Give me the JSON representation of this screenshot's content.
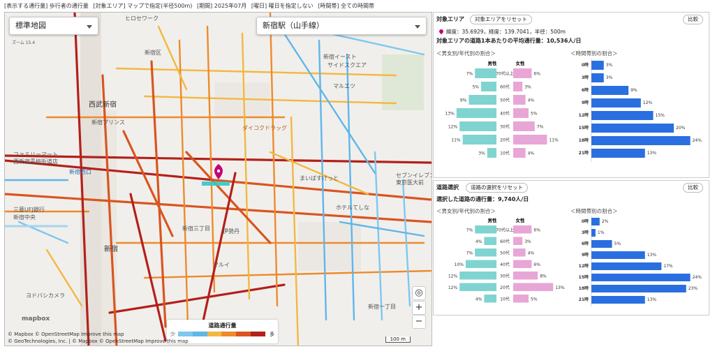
{
  "topbar": {
    "items": [
      "[表示する通行量] 歩行者の通行量",
      "[対象エリア] マップで指定(半径500m)",
      "[期間] 2025年07月",
      "[曜日] 曜日を指定しない",
      "[時間帯] 全ての時間帯"
    ]
  },
  "map": {
    "basemap_select": "標準地図",
    "station_select": "新宿駅（山手線）",
    "scale_mini": "ズーム 15.4",
    "labels": [
      "ヒロセワーク",
      "新宿区",
      "新宿イースト",
      "サイドスクエア",
      "マルエツ",
      "西武新宿",
      "新宿プリンス",
      "ファミリーマート",
      "西新宿青梅街道店",
      "新宿西口",
      "セブンイレブン",
      "東京医大前",
      "まいばすけっと",
      "ホテルてしな",
      "新宿三丁目",
      "伊勢丹",
      "新宿",
      "三菱UFJ銀行",
      "新宿中央",
      "ヨドバシカメラ",
      "新宿一丁目",
      "マルイ",
      "ダイコクドラッグ"
    ],
    "legend_title": "道路通行量",
    "legend_low": "少",
    "legend_high": "多",
    "attribution1": "© Mapbox © OpenStreetMap Improve this map",
    "attribution2": "© GeoTechnologies, Inc. | © Mapbox © OpenStreetMap Improve this map",
    "logo": "mapbox",
    "scale_bar": "100 m",
    "zoom_in": "+",
    "zoom_out": "−"
  },
  "panel_area": {
    "heading": "対象エリア",
    "reset": "対象エリアをリセット",
    "compare": "比較",
    "coords": "緯度：35.6929，経度：139.7041，半径：500m",
    "avg": "対象エリアの道路1本あたりの平均通行量：10,536人/日",
    "gender_title": "＜男女別/年代別の割合＞",
    "time_title": "＜時間帯別の割合＞"
  },
  "panel_road": {
    "heading": "道路選択",
    "reset": "道路の選択をリセット",
    "compare": "比較",
    "avg": "選択した道路の通行量：9,740人/日",
    "gender_title": "＜男女別/年代別の割合＞",
    "time_title": "＜時間帯別の割合＞"
  },
  "chart_data": [
    {
      "type": "bar",
      "title": "＜男女別/年代別の割合＞",
      "categories": [
        "70代以上",
        "60代",
        "50代",
        "40代",
        "30代",
        "20代",
        "10代"
      ],
      "series": [
        {
          "name": "男性",
          "values": [
            7,
            5,
            9,
            13,
            12,
            11,
            3
          ]
        },
        {
          "name": "女性",
          "values": [
            6,
            3,
            4,
            5,
            7,
            11,
            4
          ]
        }
      ],
      "unit": "%"
    },
    {
      "type": "bar",
      "title": "＜時間帯別の割合＞",
      "categories": [
        "0時",
        "3時",
        "6時",
        "9時",
        "12時",
        "15時",
        "18時",
        "21時"
      ],
      "values": [
        3,
        3,
        9,
        12,
        15,
        20,
        24,
        13
      ],
      "unit": "%"
    },
    {
      "type": "bar",
      "title": "＜男女別/年代別の割合＞",
      "categories": [
        "70代以上",
        "60代",
        "50代",
        "40代",
        "30代",
        "20代",
        "10代"
      ],
      "series": [
        {
          "name": "男性",
          "values": [
            7,
            4,
            7,
            10,
            12,
            12,
            4
          ]
        },
        {
          "name": "女性",
          "values": [
            6,
            3,
            4,
            6,
            8,
            13,
            5
          ]
        }
      ],
      "unit": "%"
    },
    {
      "type": "bar",
      "title": "＜時間帯別の割合＞",
      "categories": [
        "0時",
        "3時",
        "6時",
        "9時",
        "12時",
        "15時",
        "18時",
        "21時"
      ],
      "values": [
        2,
        1,
        5,
        13,
        17,
        24,
        23,
        13
      ],
      "unit": "%"
    }
  ]
}
